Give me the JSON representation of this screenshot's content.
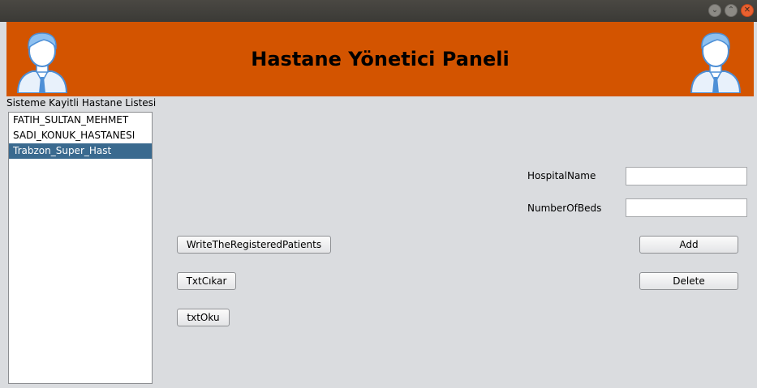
{
  "window": {
    "controls": [
      "minimize-icon",
      "maximize-icon",
      "close-icon"
    ]
  },
  "header": {
    "title": "Hastane Yönetici Paneli",
    "background": "#d35400",
    "left_icon": "user-avatar-icon",
    "right_icon": "user-avatar-icon"
  },
  "hospital_list": {
    "label": "Sisteme Kayitli Hastane Listesi",
    "items": [
      "FATIH_SULTAN_MEHMET",
      "SADI_KONUK_HASTANESI",
      "Trabzon_Super_Hast"
    ],
    "selected": "Trabzon_Super_Hast",
    "selection_color": "#3a6a8f"
  },
  "form": {
    "hospital_name_label": "HospitalName",
    "hospital_name_value": "",
    "number_of_beds_label": "NumberOfBeds",
    "number_of_beds_value": ""
  },
  "buttons": {
    "write_patients": "WriteTheRegisteredPatients",
    "txt_cikar": "TxtCıkar",
    "txt_oku": "txtOku",
    "add": "Add",
    "delete": "Delete"
  }
}
